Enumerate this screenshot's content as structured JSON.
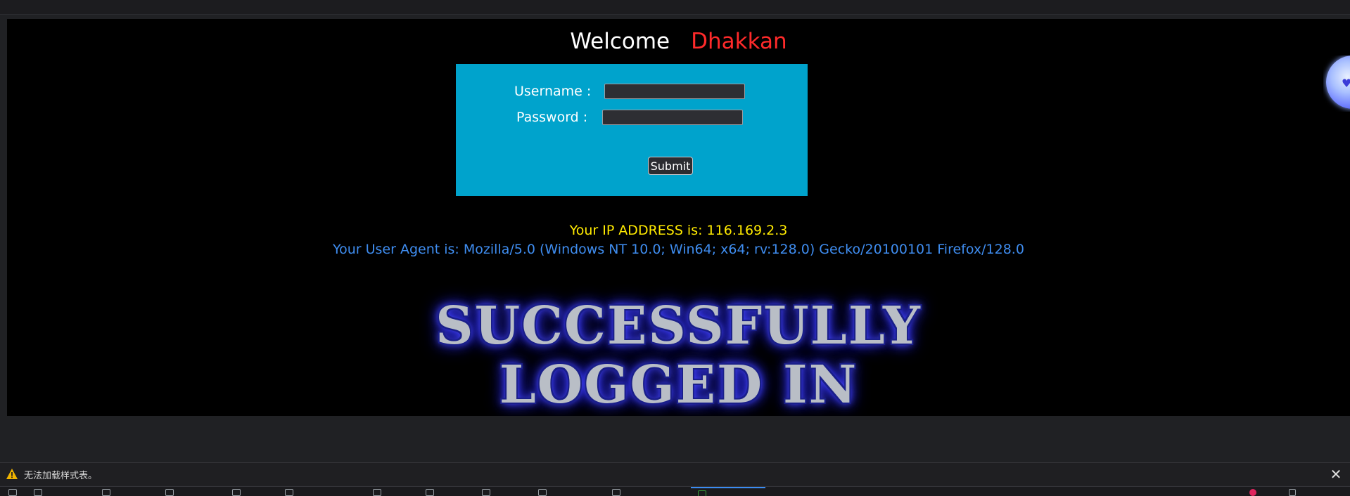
{
  "welcome": {
    "greeting": "Welcome",
    "name": "Dhakkan"
  },
  "form": {
    "username_label": "Username :",
    "username_value": "",
    "password_label": "Password :",
    "password_value": "",
    "submit_label": "Submit"
  },
  "info": {
    "ip_line": "Your IP ADDRESS is: 116.169.2.3",
    "ua_line": "Your User Agent is: Mozilla/5.0 (Windows NT 10.0; Win64; x64; rv:128.0) Gecko/20100101 Firefox/128.0"
  },
  "banner": {
    "line1": "SUCCESSFULLY",
    "line2": "LOGGED IN"
  },
  "notice": {
    "text": "无法加载样式表。",
    "icon": "warning-icon",
    "close_icon": "close-icon"
  },
  "colors": {
    "welcome_name": "#ff2a2a",
    "login_box": "#00a3cc",
    "ip_text": "#ffea00",
    "ua_text": "#3f8df0",
    "page_bg": "#000000"
  }
}
